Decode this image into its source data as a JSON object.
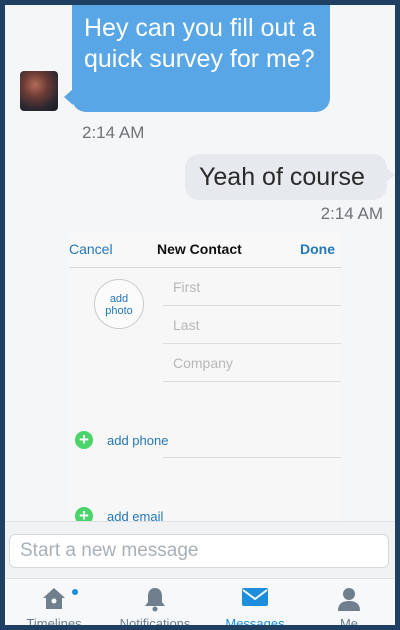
{
  "conversation": {
    "incoming": {
      "text": "Hey can you fill out a quick survey for me?",
      "time": "2:14 AM"
    },
    "outgoing": {
      "text": "Yeah of course",
      "time": "2:14 AM"
    }
  },
  "attachment": {
    "cancel_label": "Cancel",
    "title": "New Contact",
    "done_label": "Done",
    "add_photo_label": "add photo",
    "fields": [
      "First",
      "Last",
      "Company"
    ],
    "add_phone_label": "add phone",
    "add_email_label": "add email"
  },
  "composer": {
    "placeholder": "Start a new message"
  },
  "tabs": [
    {
      "label": "Timelines",
      "icon": "home-icon",
      "active": false,
      "has_dot": true
    },
    {
      "label": "Notifications",
      "icon": "bell-icon",
      "active": false,
      "has_dot": false
    },
    {
      "label": "Messages",
      "icon": "envelope-icon",
      "active": true,
      "has_dot": false
    },
    {
      "label": "Me",
      "icon": "person-icon",
      "active": false,
      "has_dot": false
    }
  ],
  "colors": {
    "frame": "#1f3f63",
    "incoming_bubble": "#59a6e6",
    "outgoing_bubble": "#e6e9ed",
    "accent": "#1d8edc",
    "add_green": "#4bd46a"
  }
}
